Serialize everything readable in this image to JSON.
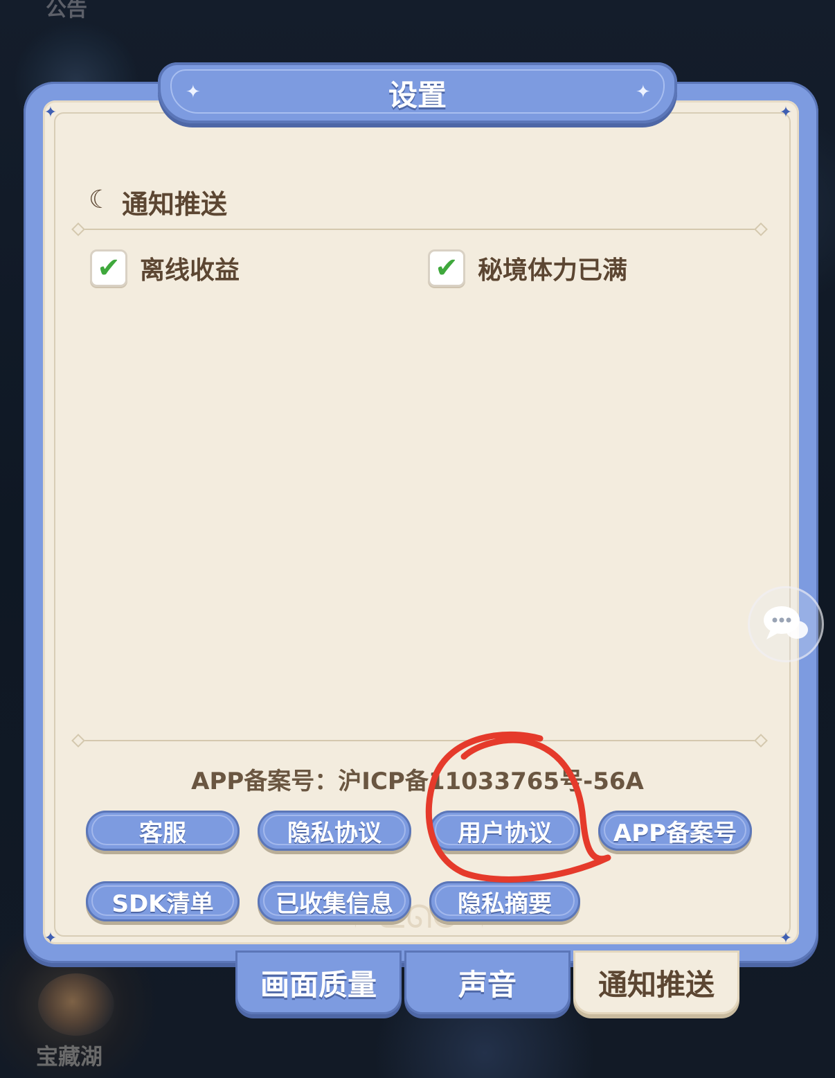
{
  "background": {
    "notice_label": "公告",
    "treasure_lake_label": "宝藏湖"
  },
  "dialog": {
    "title": "设置",
    "section_title": "通知推送",
    "options": [
      {
        "label": "离线收益",
        "checked": true
      },
      {
        "label": "秘境体力已满",
        "checked": true
      }
    ],
    "icp_text": "APP备案号：沪ICP备11033765号-56A",
    "buttons_row1": [
      "客服",
      "隐私协议",
      "用户协议",
      "APP备案号"
    ],
    "buttons_row2": [
      "SDK清单",
      "已收集信息",
      "隐私摘要"
    ]
  },
  "tabs": [
    {
      "label": "画面质量",
      "active": false
    },
    {
      "label": "声音",
      "active": false
    },
    {
      "label": "通知推送",
      "active": true
    }
  ],
  "annotation": {
    "color": "#e53a2b",
    "target": "用户协议"
  },
  "colors": {
    "frame_blue": "#7d9be0",
    "panel_cream": "#f3ecde",
    "text_brown": "#5c4632",
    "check_green": "#3fa83c"
  },
  "icons": {
    "section": "moon-icon",
    "chat": "chat-bubbles-icon",
    "check": "checkmark-icon"
  }
}
